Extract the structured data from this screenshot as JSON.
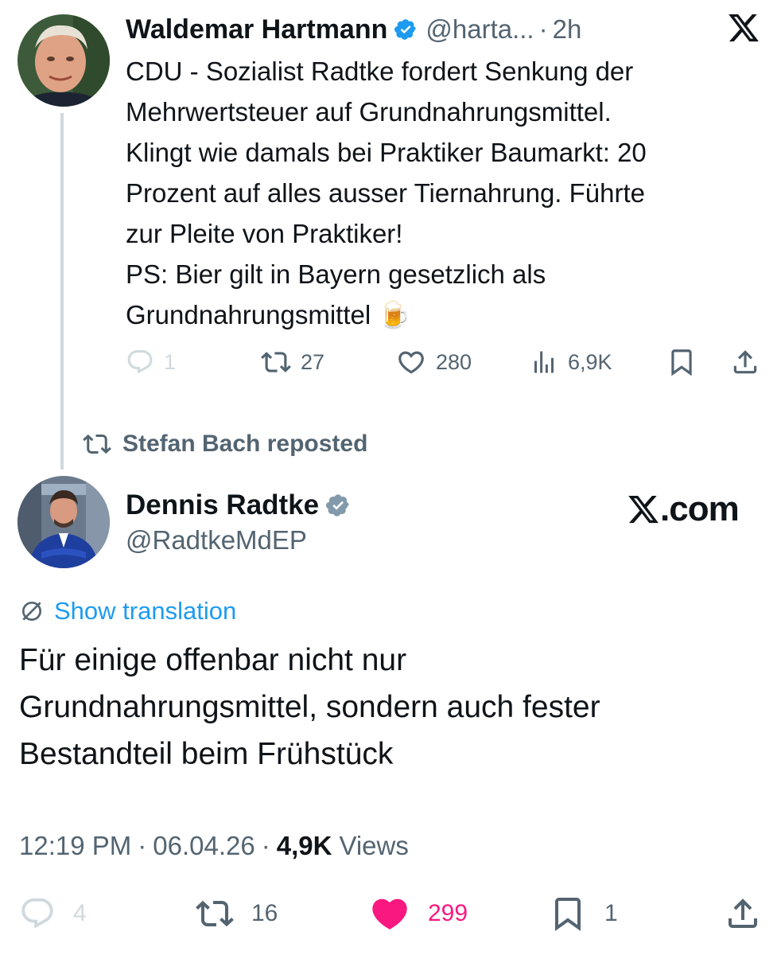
{
  "colors": {
    "text": "#0f1419",
    "secondary": "#536471",
    "accent_link": "#1d9bf0",
    "like_pink": "#f91880",
    "verified_blue": "#1d9bf0",
    "verified_gray": "#829aab",
    "disabled": "#cfd9de"
  },
  "quoted_tweet": {
    "author_name": "Waldemar Hartmann",
    "handle": "@harta...",
    "separator": "·",
    "time": "2h",
    "verified_icon": "verified-badge-blue",
    "text": "CDU - Sozialist Radtke fordert Senkung der\nMehrwertsteuer auf Grundnahrungsmittel.\nKlingt wie damals bei Praktiker Baumarkt: 20\nProzent auf alles ausser Tiernahrung. Führte\nzur Pleite von Praktiker!\nPS: Bier gilt in Bayern gesetzlich als\nGrundnahrungsmittel 🍺",
    "actions": {
      "replies": "1",
      "reposts": "27",
      "likes": "280",
      "views": "6,9K"
    }
  },
  "repost_banner": {
    "text": "Stefan Bach reposted",
    "icon": "repost-icon"
  },
  "main_tweet": {
    "author_name": "Dennis Radtke",
    "handle": "@RadtkeMdEP",
    "verified_icon": "verified-badge-gray",
    "branding": ".com",
    "translation_label": "Show translation",
    "text": "Für einige offenbar nicht nur\nGrundnahrungsmittel, sondern auch fester\nBestandteil beim Frühstück",
    "time": "12:19 PM",
    "date": "06.04.26",
    "separator": "·",
    "views_count": "4,9K",
    "views_label": "Views",
    "actions": {
      "replies": "4",
      "reposts": "16",
      "likes": "299",
      "bookmarks": "1"
    }
  }
}
